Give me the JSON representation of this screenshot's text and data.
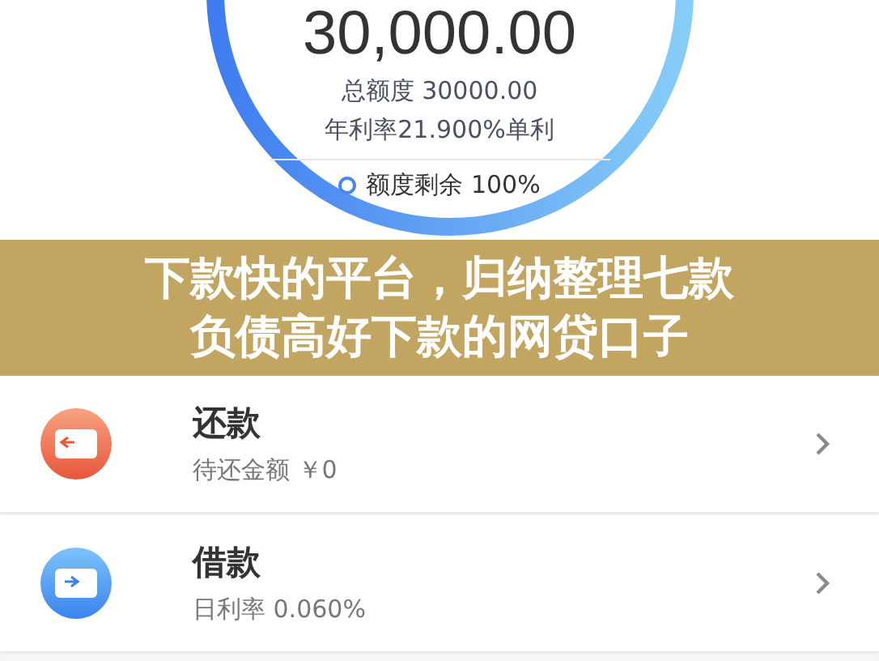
{
  "credit": {
    "available": "30,000.00",
    "total": "总额度 30000.00",
    "rate": "年利率21.900%单利",
    "remaining": "额度剩余 100%"
  },
  "banner": {
    "lines": [
      "下款快的平台，归纳整理七款",
      "负债高好下款的网贷口子"
    ]
  },
  "items": [
    {
      "kind": "repay",
      "title": "还款",
      "subtitle": "待还金额 ￥0"
    },
    {
      "kind": "borrow",
      "title": "借款",
      "subtitle": "日利率 0.060%"
    }
  ]
}
